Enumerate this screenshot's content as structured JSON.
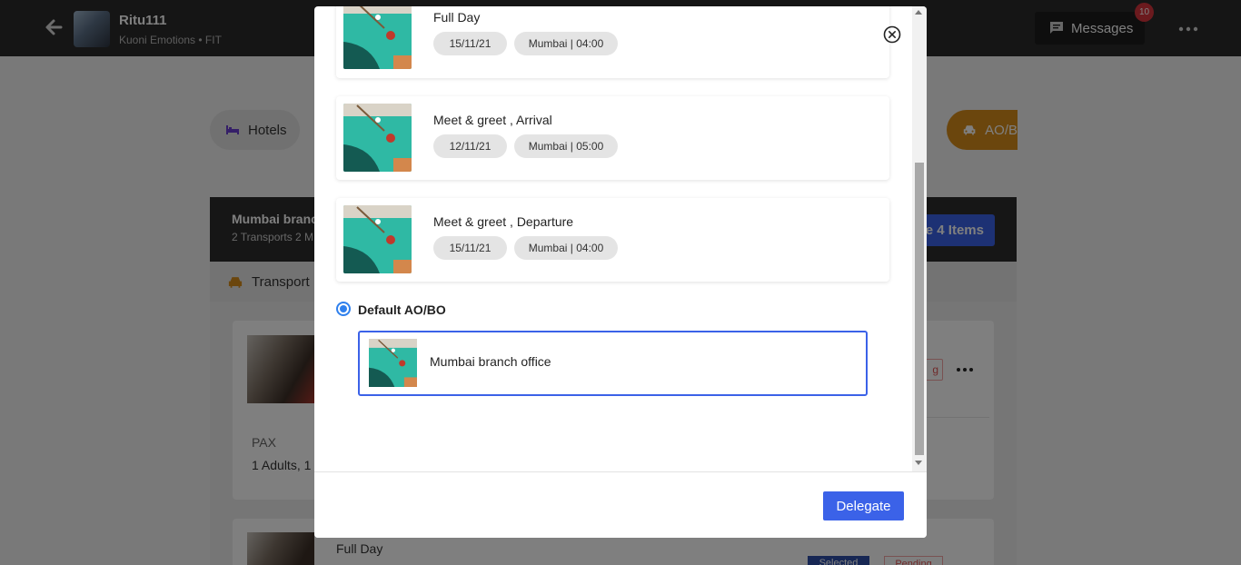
{
  "header": {
    "user_name": "Ritu111",
    "user_subtitle": "Kuoni Emotions • FIT",
    "messages_label": "Messages",
    "messages_count": "10"
  },
  "filters": {
    "hotels_label": "Hotels",
    "aobo_label": "AO/B"
  },
  "summary": {
    "title": "Mumbai branc",
    "subtitle": "2 Transports 2 M",
    "items_button": "e 4 Items"
  },
  "section": {
    "transport_label": "Transport"
  },
  "background_card": {
    "pax_label": "PAX",
    "pax_value": "1 Adults, 1",
    "status_tag": "g",
    "second_title": "Full Day",
    "selected_tag": "Selected",
    "pending_tag": "Pending"
  },
  "modal": {
    "services": [
      {
        "title": "Full Day",
        "date": "15/11/21",
        "location_time": "Mumbai | 04:00"
      },
      {
        "title": "Meet & greet , Arrival",
        "date": "12/11/21",
        "location_time": "Mumbai | 05:00"
      },
      {
        "title": "Meet & greet , Departure",
        "date": "15/11/21",
        "location_time": "Mumbai | 04:00"
      }
    ],
    "radio_label": "Default AO/BO",
    "radio_checked": true,
    "office_name": "Mumbai branch office",
    "delegate_label": "Delegate"
  },
  "colors": {
    "primary": "#3b62e8",
    "radio": "#2f80ed",
    "accent_orange": "#d68c1a",
    "topbar": "#2b2b2b",
    "badge": "#d6343c"
  },
  "icons": [
    "back-arrow-icon",
    "chat-icon",
    "more-horizontal-icon",
    "bed-icon",
    "car-icon",
    "close-circle-icon"
  ]
}
